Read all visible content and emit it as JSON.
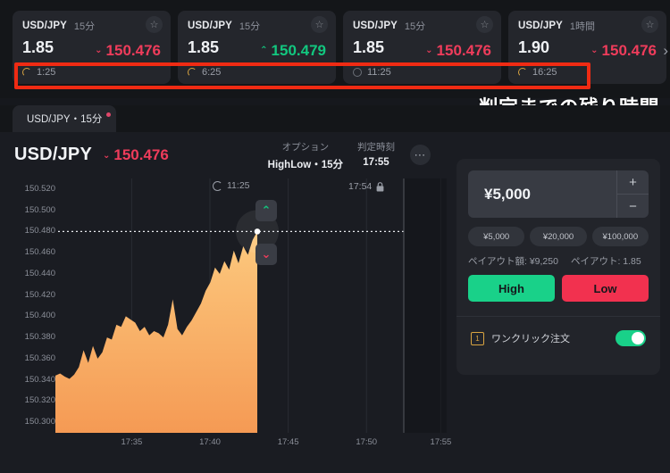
{
  "ticker_cards": [
    {
      "pair": "USD/JPY",
      "duration": "15分",
      "payout": "1.85",
      "price": "150.476",
      "direction": "down",
      "caret": "⌄",
      "countdown": "1:25",
      "star": "☆"
    },
    {
      "pair": "USD/JPY",
      "duration": "15分",
      "payout": "1.85",
      "price": "150.479",
      "direction": "up",
      "caret": "⌃",
      "countdown": "6:25",
      "star": "☆"
    },
    {
      "pair": "USD/JPY",
      "duration": "15分",
      "payout": "1.85",
      "price": "150.476",
      "direction": "down",
      "caret": "⌄",
      "countdown": "11:25",
      "star": "☆"
    },
    {
      "pair": "USD/JPY",
      "duration": "1時間",
      "payout": "1.90",
      "price": "150.476",
      "direction": "down",
      "caret": "⌄",
      "countdown": "16:25",
      "star": "☆"
    }
  ],
  "strip_chevron": "›",
  "annotation": {
    "text": "判定までの残り時間",
    "box_color": "#f02b13",
    "arrow_color": "#f02b13"
  },
  "tab": {
    "label": "USD/JPY・15分"
  },
  "chart_header": {
    "pair": "USD/JPY",
    "price": "150.476",
    "caret": "⌄",
    "price_color": "#ef3c5b",
    "option_label": "オプション",
    "option_value": "HighLow・15分",
    "judge_label": "判定時刻",
    "judge_value": "17:55",
    "more": "⋯"
  },
  "chart_data": {
    "type": "area",
    "title": "USD/JPY",
    "xlabel": "",
    "ylabel": "",
    "ylim": [
      150.29,
      150.53
    ],
    "ytick_labels": [
      "150.520",
      "150.500",
      "150.480",
      "150.460",
      "150.440",
      "150.420",
      "150.400",
      "150.380",
      "150.360",
      "150.340",
      "150.320",
      "150.300"
    ],
    "ytick_values": [
      150.52,
      150.5,
      150.48,
      150.46,
      150.44,
      150.42,
      150.4,
      150.38,
      150.36,
      150.34,
      150.32,
      150.3
    ],
    "xtick_labels": [
      "17:35",
      "17:40",
      "17:45",
      "17:50",
      "17:55"
    ],
    "xtick_positions": [
      0.195,
      0.395,
      0.595,
      0.795,
      0.985
    ],
    "grid": true,
    "series_color": "#f6a94f",
    "current_price_line": 150.48,
    "current_price_line_style": "dotted",
    "countdown_marker": "11:25",
    "lock_label": "17:54",
    "lock_icon": "🔒",
    "up_arrow": "⌃",
    "down_arrow": "⌄",
    "x": [
      0.0,
      0.012,
      0.024,
      0.036,
      0.048,
      0.06,
      0.072,
      0.084,
      0.096,
      0.108,
      0.12,
      0.132,
      0.144,
      0.156,
      0.168,
      0.18,
      0.192,
      0.204,
      0.216,
      0.228,
      0.24,
      0.252,
      0.264,
      0.276,
      0.288,
      0.3,
      0.312,
      0.324,
      0.336,
      0.348,
      0.36,
      0.372,
      0.384,
      0.396,
      0.408,
      0.42,
      0.432,
      0.444,
      0.456,
      0.468,
      0.48,
      0.492,
      0.504,
      0.516
    ],
    "y": [
      150.344,
      150.346,
      150.343,
      150.341,
      150.345,
      150.352,
      150.368,
      150.356,
      150.372,
      150.36,
      150.366,
      150.38,
      150.378,
      150.392,
      150.39,
      150.4,
      150.397,
      150.394,
      150.386,
      150.39,
      150.382,
      150.386,
      150.384,
      150.38,
      150.392,
      150.416,
      150.388,
      150.382,
      150.39,
      150.396,
      150.404,
      150.412,
      150.424,
      150.432,
      150.446,
      150.44,
      150.452,
      150.444,
      150.462,
      150.45,
      150.466,
      150.458,
      150.472,
      150.48
    ]
  },
  "trade_panel": {
    "amount": "¥5,000",
    "increment": "+",
    "decrement": "−",
    "quick_amounts": [
      "¥5,000",
      "¥20,000",
      "¥100,000"
    ],
    "payout_amount_label": "ペイアウト額: ¥9,250",
    "payout_rate_label": "ペイアウト: 1.85",
    "high_label": "High",
    "low_label": "Low",
    "high_color": "#19d189",
    "low_color": "#f2314f",
    "oneclick_label": "ワンクリック注文",
    "oneclick_icon": "1",
    "oneclick_enabled": true
  }
}
